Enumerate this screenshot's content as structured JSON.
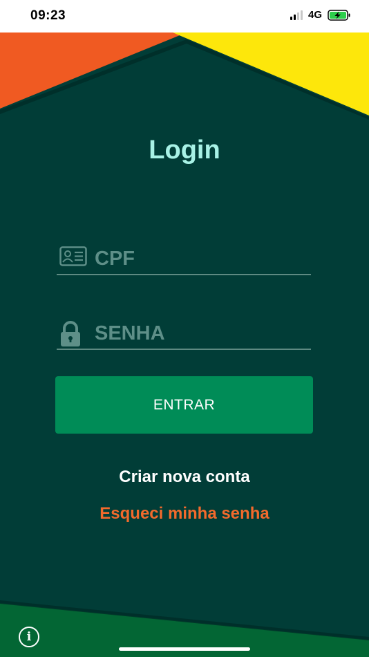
{
  "status_bar": {
    "time": "09:23",
    "network": "4G",
    "signal_bars_active": 2,
    "signal_bars_total": 4,
    "battery_state": "charging"
  },
  "login": {
    "title": "Login",
    "cpf_placeholder": "CPF",
    "senha_placeholder": "SENHA",
    "submit_label": "ENTRAR",
    "create_account_label": "Criar nova conta",
    "forgot_password_label": "Esqueci minha senha",
    "info_label": "i"
  },
  "icons": {
    "cpf": "id-card-icon",
    "senha": "lock-icon",
    "info": "info-icon"
  },
  "colors": {
    "background": "#013d37",
    "accent_orange": "#f26a2c",
    "accent_yellow": "#fde70b",
    "title_mint": "#a8f2e6",
    "button_green": "#008c57",
    "footer_green": "#036634"
  }
}
